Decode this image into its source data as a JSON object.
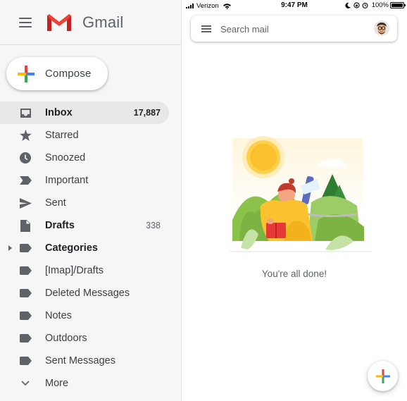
{
  "drawer": {
    "app_name": "Gmail",
    "compose_label": "Compose",
    "items": [
      {
        "label": "Inbox",
        "count": "17,887",
        "icon": "inbox-icon",
        "active": true,
        "bold": true
      },
      {
        "label": "Starred",
        "count": "",
        "icon": "star-icon"
      },
      {
        "label": "Snoozed",
        "count": "",
        "icon": "clock-icon"
      },
      {
        "label": "Important",
        "count": "",
        "icon": "important-icon"
      },
      {
        "label": "Sent",
        "count": "",
        "icon": "send-icon"
      },
      {
        "label": "Drafts",
        "count": "338",
        "icon": "draft-icon",
        "bold": true
      },
      {
        "label": "Categories",
        "count": "",
        "icon": "label-icon",
        "bold": true,
        "expandable": true
      },
      {
        "label": "[Imap]/Drafts",
        "count": "",
        "icon": "label-icon"
      },
      {
        "label": "Deleted Messages",
        "count": "",
        "icon": "label-icon"
      },
      {
        "label": "Notes",
        "count": "",
        "icon": "label-icon"
      },
      {
        "label": "Outdoors",
        "count": "",
        "icon": "label-icon"
      },
      {
        "label": "Sent Messages",
        "count": "",
        "icon": "label-icon"
      },
      {
        "label": "More",
        "count": "",
        "icon": "chevron-down-icon"
      }
    ]
  },
  "status_bar": {
    "carrier": "Verizon",
    "time": "9:47 PM",
    "battery": "100%"
  },
  "search": {
    "placeholder": "Search mail"
  },
  "main": {
    "empty_message": "You're all done!"
  },
  "colors": {
    "gmail_red": "#ea4335",
    "google_blue": "#4285f4",
    "google_green": "#34a853",
    "google_yellow": "#fbbc04",
    "drawer_bg": "#f6f6f6",
    "active_item_bg": "#e8e8e8"
  }
}
